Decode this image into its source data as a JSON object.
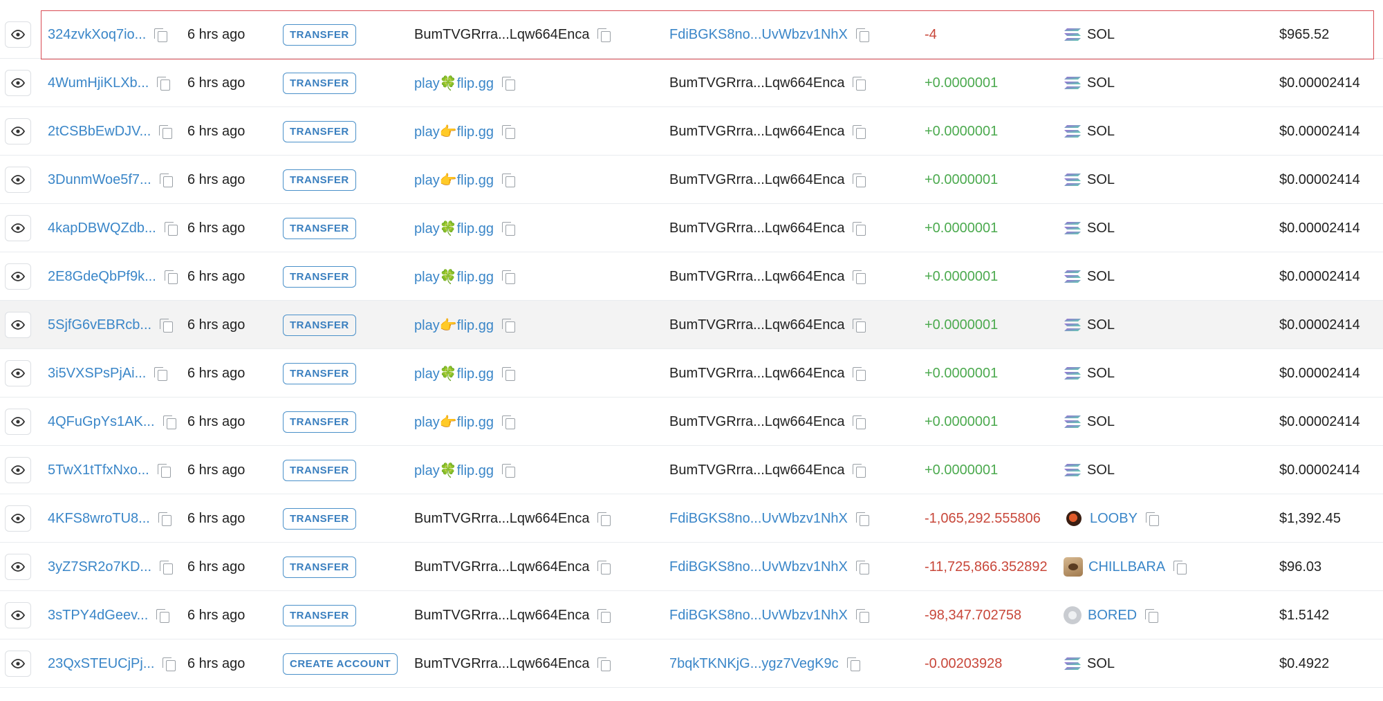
{
  "colors": {
    "link": "#3a86c8",
    "negative": "#c8473a",
    "positive": "#4caa4f",
    "badge": "#3a7fbf",
    "selected_border": "#d94a52"
  },
  "rows": [
    {
      "signature": "324zvkXoq7io...",
      "time": "6 hrs ago",
      "type": "TRANSFER",
      "from": "BumTVGRrra...Lqw664Enca",
      "from_link": false,
      "from_icon": "",
      "to": "FdiBGKS8no...UvWbzv1NhX",
      "to_link": true,
      "amount": "-4",
      "amount_sign": "negative",
      "token": "SOL",
      "token_icon": "solana-icon",
      "token_link": false,
      "value": "$965.52",
      "selected": true
    },
    {
      "signature": "4WumHjiKLXb...",
      "time": "6 hrs ago",
      "type": "TRANSFER",
      "from": "play🍀flip.gg",
      "from_link": true,
      "from_icon": "clover",
      "to": "BumTVGRrra...Lqw664Enca",
      "to_link": false,
      "amount": "+0.0000001",
      "amount_sign": "positive",
      "token": "SOL",
      "token_icon": "solana-icon",
      "token_link": false,
      "value": "$0.00002414"
    },
    {
      "signature": "2tCSBbEwDJV...",
      "time": "6 hrs ago",
      "type": "TRANSFER",
      "from": "play👉flip.gg",
      "from_link": true,
      "from_icon": "pointing-hand",
      "to": "BumTVGRrra...Lqw664Enca",
      "to_link": false,
      "amount": "+0.0000001",
      "amount_sign": "positive",
      "token": "SOL",
      "token_icon": "solana-icon",
      "token_link": false,
      "value": "$0.00002414"
    },
    {
      "signature": "3DunmWoe5f7...",
      "time": "6 hrs ago",
      "type": "TRANSFER",
      "from": "play👉flip.gg",
      "from_link": true,
      "from_icon": "pointing-hand",
      "to": "BumTVGRrra...Lqw664Enca",
      "to_link": false,
      "amount": "+0.0000001",
      "amount_sign": "positive",
      "token": "SOL",
      "token_icon": "solana-icon",
      "token_link": false,
      "value": "$0.00002414"
    },
    {
      "signature": "4kapDBWQZdb...",
      "time": "6 hrs ago",
      "type": "TRANSFER",
      "from": "play🍀flip.gg",
      "from_link": true,
      "from_icon": "clover",
      "to": "BumTVGRrra...Lqw664Enca",
      "to_link": false,
      "amount": "+0.0000001",
      "amount_sign": "positive",
      "token": "SOL",
      "token_icon": "solana-icon",
      "token_link": false,
      "value": "$0.00002414"
    },
    {
      "signature": "2E8GdeQbPf9k...",
      "time": "6 hrs ago",
      "type": "TRANSFER",
      "from": "play🍀flip.gg",
      "from_link": true,
      "from_icon": "clover",
      "to": "BumTVGRrra...Lqw664Enca",
      "to_link": false,
      "amount": "+0.0000001",
      "amount_sign": "positive",
      "token": "SOL",
      "token_icon": "solana-icon",
      "token_link": false,
      "value": "$0.00002414"
    },
    {
      "signature": "5SjfG6vEBRcb...",
      "time": "6 hrs ago",
      "type": "TRANSFER",
      "from": "play👉flip.gg",
      "from_link": true,
      "from_icon": "pointing-hand",
      "to": "BumTVGRrra...Lqw664Enca",
      "to_link": false,
      "amount": "+0.0000001",
      "amount_sign": "positive",
      "token": "SOL",
      "token_icon": "solana-icon",
      "token_link": false,
      "value": "$0.00002414",
      "highlighted": true
    },
    {
      "signature": "3i5VXSPsPjAi...",
      "time": "6 hrs ago",
      "type": "TRANSFER",
      "from": "play🍀flip.gg",
      "from_link": true,
      "from_icon": "clover",
      "to": "BumTVGRrra...Lqw664Enca",
      "to_link": false,
      "amount": "+0.0000001",
      "amount_sign": "positive",
      "token": "SOL",
      "token_icon": "solana-icon",
      "token_link": false,
      "value": "$0.00002414"
    },
    {
      "signature": "4QFuGpYs1AK...",
      "time": "6 hrs ago",
      "type": "TRANSFER",
      "from": "play👉flip.gg",
      "from_link": true,
      "from_icon": "pointing-hand",
      "to": "BumTVGRrra...Lqw664Enca",
      "to_link": false,
      "amount": "+0.0000001",
      "amount_sign": "positive",
      "token": "SOL",
      "token_icon": "solana-icon",
      "token_link": false,
      "value": "$0.00002414"
    },
    {
      "signature": "5TwX1tTfxNxo...",
      "time": "6 hrs ago",
      "type": "TRANSFER",
      "from": "play🍀flip.gg",
      "from_link": true,
      "from_icon": "clover",
      "to": "BumTVGRrra...Lqw664Enca",
      "to_link": false,
      "amount": "+0.0000001",
      "amount_sign": "positive",
      "token": "SOL",
      "token_icon": "solana-icon",
      "token_link": false,
      "value": "$0.00002414"
    },
    {
      "signature": "4KFS8wroTU8...",
      "time": "6 hrs ago",
      "type": "TRANSFER",
      "from": "BumTVGRrra...Lqw664Enca",
      "from_link": false,
      "from_icon": "",
      "to": "FdiBGKS8no...UvWbzv1NhX",
      "to_link": true,
      "amount": "-1,065,292.555806",
      "amount_sign": "negative",
      "token": "LOOBY",
      "token_icon": "looby-icon",
      "token_link": true,
      "value": "$1,392.45"
    },
    {
      "signature": "3yZ7SR2o7KD...",
      "time": "6 hrs ago",
      "type": "TRANSFER",
      "from": "BumTVGRrra...Lqw664Enca",
      "from_link": false,
      "from_icon": "",
      "to": "FdiBGKS8no...UvWbzv1NhX",
      "to_link": true,
      "amount": "-11,725,866.352892",
      "amount_sign": "negative",
      "token": "CHILLBARA",
      "token_icon": "chillbara-icon",
      "token_link": true,
      "value": "$96.03"
    },
    {
      "signature": "3sTPY4dGeev...",
      "time": "6 hrs ago",
      "type": "TRANSFER",
      "from": "BumTVGRrra...Lqw664Enca",
      "from_link": false,
      "from_icon": "",
      "to": "FdiBGKS8no...UvWbzv1NhX",
      "to_link": true,
      "amount": "-98,347.702758",
      "amount_sign": "negative",
      "token": "BORED",
      "token_icon": "bored-icon",
      "token_link": true,
      "value": "$1.5142"
    },
    {
      "signature": "23QxSTEUCjPj...",
      "time": "6 hrs ago",
      "type": "CREATE ACCOUNT",
      "from": "BumTVGRrra...Lqw664Enca",
      "from_link": false,
      "from_icon": "",
      "to": "7bqkTKNKjG...ygz7VegK9c",
      "to_link": true,
      "amount": "-0.00203928",
      "amount_sign": "negative",
      "token": "SOL",
      "token_icon": "solana-icon",
      "token_link": false,
      "value": "$0.4922"
    }
  ]
}
